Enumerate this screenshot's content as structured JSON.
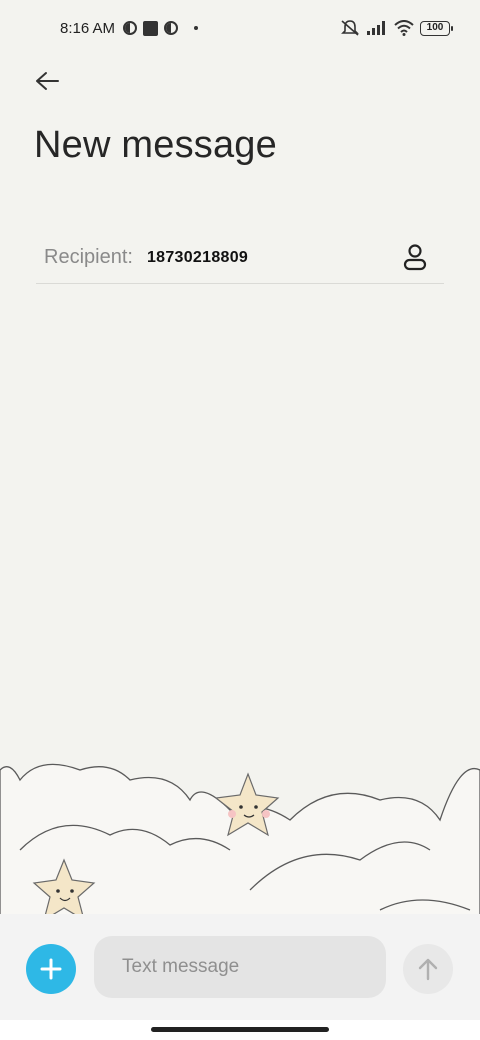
{
  "status_bar": {
    "time": "8:16 AM",
    "battery": "100",
    "icons": [
      "notification-circle-icon",
      "square-app-icon",
      "notification-circle-icon",
      "dot-icon",
      "mute-icon",
      "signal-icon",
      "wifi-icon",
      "battery-icon"
    ]
  },
  "header": {
    "back_icon": "arrow-left-icon",
    "title": "New message"
  },
  "recipient": {
    "label": "Recipient:",
    "value": "18730218809",
    "contact_icon": "person-icon"
  },
  "composer": {
    "add_icon": "plus-icon",
    "placeholder": "Text message",
    "send_icon": "arrow-up-icon"
  },
  "colors": {
    "background": "#f3f3ef",
    "accent": "#2eb8e6",
    "input_bg": "#e4e4e4"
  }
}
